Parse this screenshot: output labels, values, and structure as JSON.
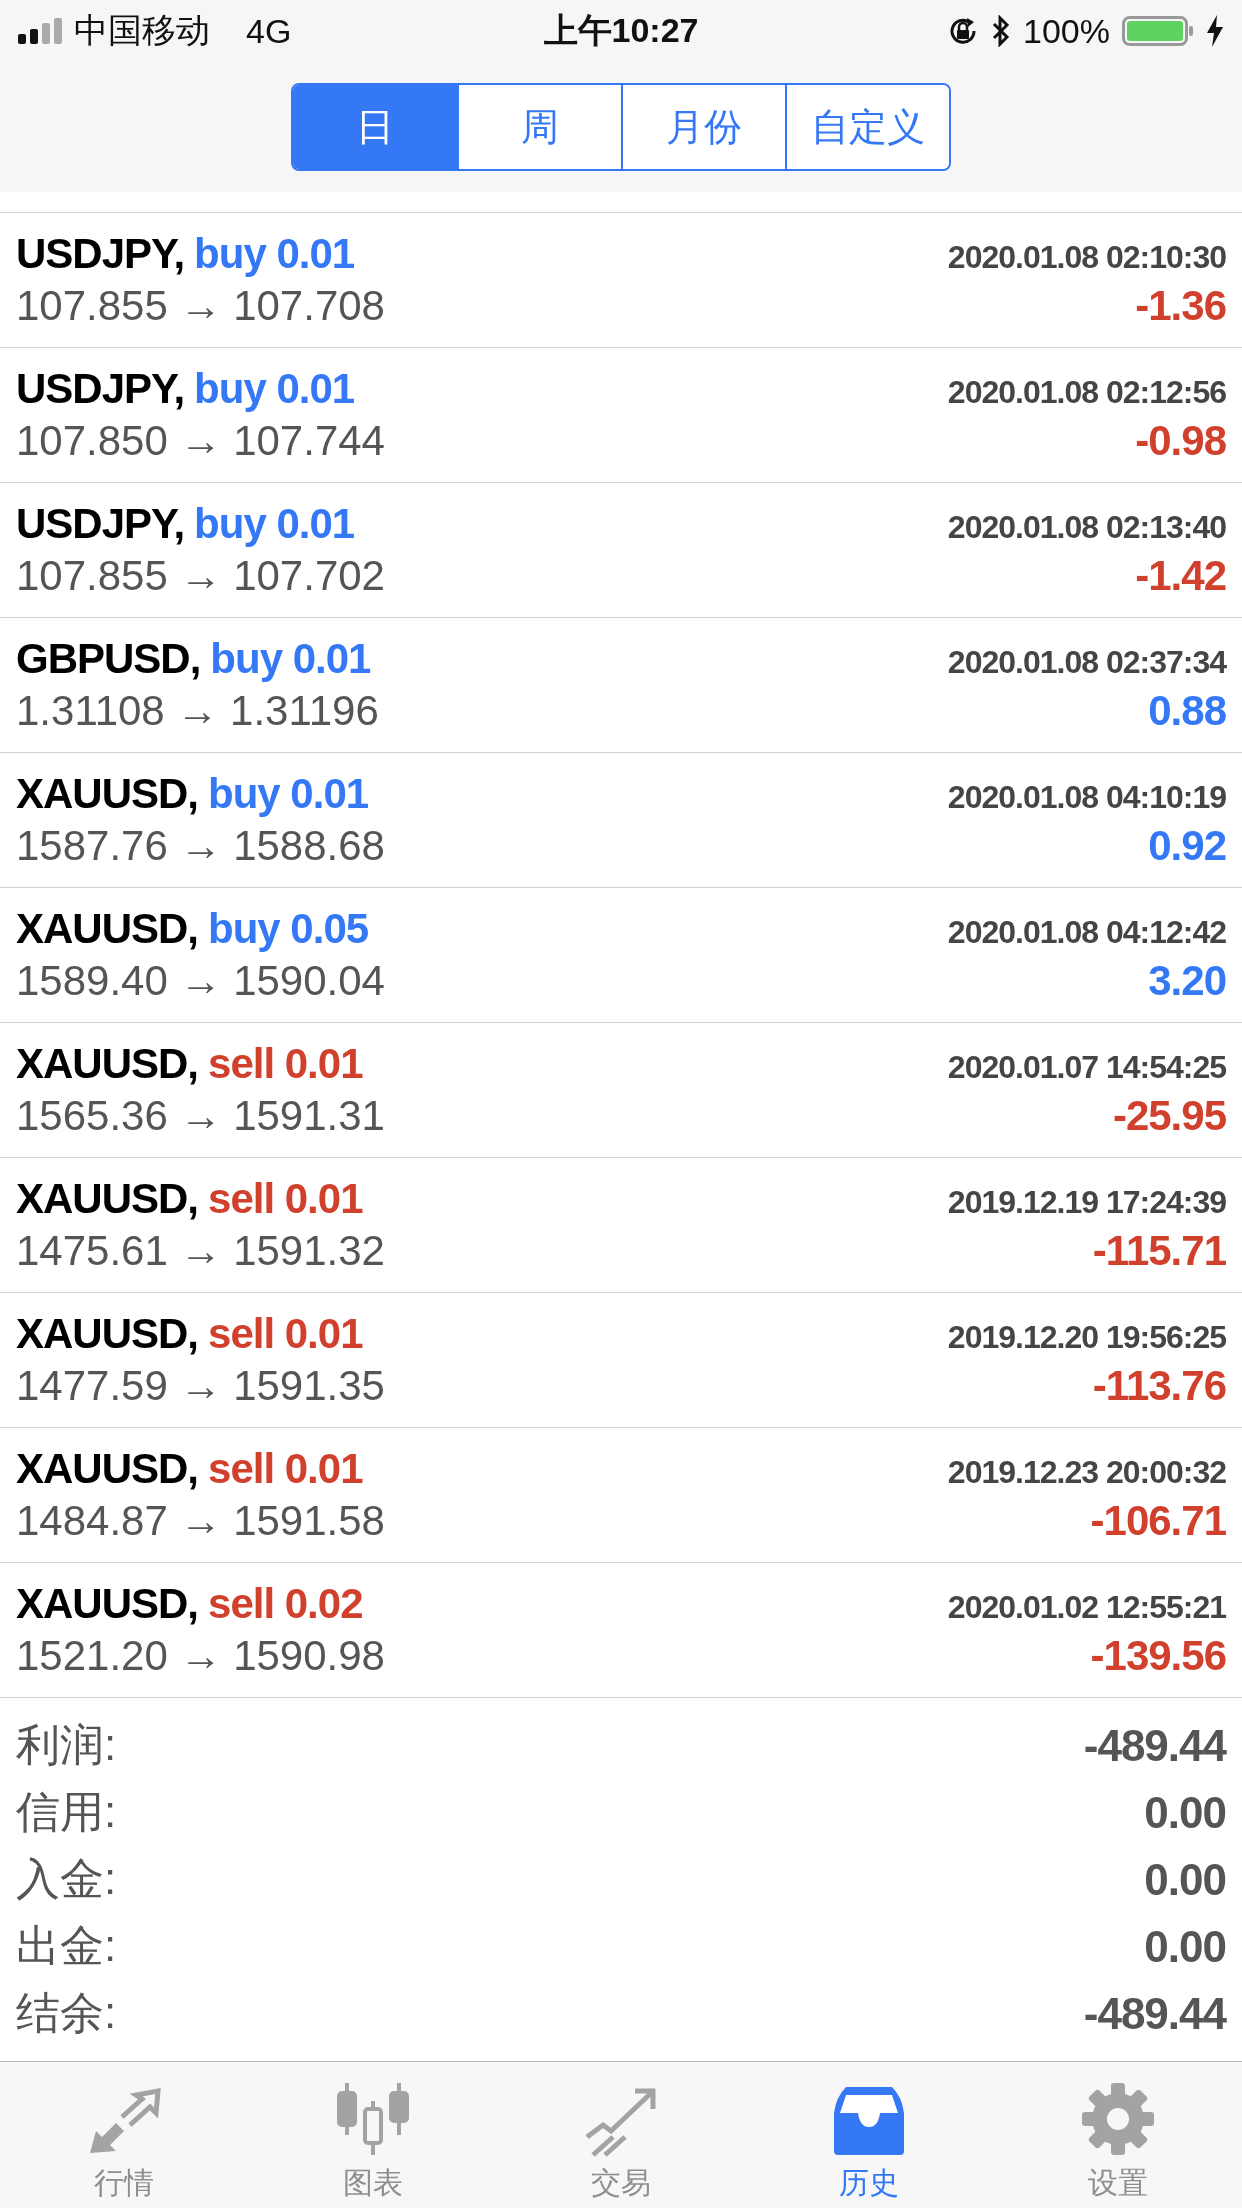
{
  "status_bar": {
    "carrier": "中国移动",
    "network": "4G",
    "time": "上午10:27",
    "battery": "100%"
  },
  "segments": [
    {
      "label": "日",
      "selected": true
    },
    {
      "label": "周",
      "selected": false
    },
    {
      "label": "月份",
      "selected": false
    },
    {
      "label": "自定义",
      "selected": false
    }
  ],
  "trades": [
    {
      "symbol": "USDJPY,",
      "order": "buy 0.01",
      "kind": "buy",
      "time": "2020.01.08 02:10:30",
      "prices": "107.855 → 107.708",
      "profit": "-1.36",
      "loss": true
    },
    {
      "symbol": "USDJPY,",
      "order": "buy 0.01",
      "kind": "buy",
      "time": "2020.01.08 02:12:56",
      "prices": "107.850 → 107.744",
      "profit": "-0.98",
      "loss": true
    },
    {
      "symbol": "USDJPY,",
      "order": "buy 0.01",
      "kind": "buy",
      "time": "2020.01.08 02:13:40",
      "prices": "107.855 → 107.702",
      "profit": "-1.42",
      "loss": true
    },
    {
      "symbol": "GBPUSD,",
      "order": "buy 0.01",
      "kind": "buy",
      "time": "2020.01.08 02:37:34",
      "prices": "1.31108 → 1.31196",
      "profit": "0.88",
      "loss": false
    },
    {
      "symbol": "XAUUSD,",
      "order": "buy 0.01",
      "kind": "buy",
      "time": "2020.01.08 04:10:19",
      "prices": "1587.76 → 1588.68",
      "profit": "0.92",
      "loss": false
    },
    {
      "symbol": "XAUUSD,",
      "order": "buy 0.05",
      "kind": "buy",
      "time": "2020.01.08 04:12:42",
      "prices": "1589.40 → 1590.04",
      "profit": "3.20",
      "loss": false
    },
    {
      "symbol": "XAUUSD,",
      "order": "sell 0.01",
      "kind": "sell",
      "time": "2020.01.07 14:54:25",
      "prices": "1565.36 → 1591.31",
      "profit": "-25.95",
      "loss": true
    },
    {
      "symbol": "XAUUSD,",
      "order": "sell 0.01",
      "kind": "sell",
      "time": "2019.12.19 17:24:39",
      "prices": "1475.61 → 1591.32",
      "profit": "-115.71",
      "loss": true
    },
    {
      "symbol": "XAUUSD,",
      "order": "sell 0.01",
      "kind": "sell",
      "time": "2019.12.20 19:56:25",
      "prices": "1477.59 → 1591.35",
      "profit": "-113.76",
      "loss": true
    },
    {
      "symbol": "XAUUSD,",
      "order": "sell 0.01",
      "kind": "sell",
      "time": "2019.12.23 20:00:32",
      "prices": "1484.87 → 1591.58",
      "profit": "-106.71",
      "loss": true
    },
    {
      "symbol": "XAUUSD,",
      "order": "sell 0.02",
      "kind": "sell",
      "time": "2020.01.02 12:55:21",
      "prices": "1521.20 → 1590.98",
      "profit": "-139.56",
      "loss": true
    }
  ],
  "summary": [
    {
      "label": "利润:",
      "value": "-489.44"
    },
    {
      "label": "信用:",
      "value": "0.00"
    },
    {
      "label": "入金:",
      "value": "0.00"
    },
    {
      "label": "出金:",
      "value": "0.00"
    },
    {
      "label": "结余:",
      "value": "-489.44"
    }
  ],
  "tab_bar": [
    {
      "label": "行情",
      "kind": "quotes",
      "selected": false
    },
    {
      "label": "图表",
      "kind": "chart",
      "selected": false
    },
    {
      "label": "交易",
      "kind": "trade",
      "selected": false
    },
    {
      "label": "历史",
      "kind": "history",
      "selected": true
    },
    {
      "label": "设置",
      "kind": "settings",
      "selected": false
    }
  ]
}
